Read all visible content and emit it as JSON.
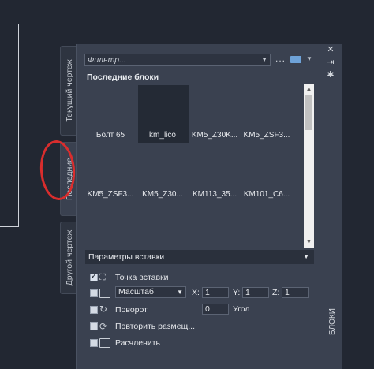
{
  "tabs": [
    {
      "label": "Текущий чертеж",
      "active": false
    },
    {
      "label": "Последние",
      "active": true
    },
    {
      "label": "Другой чертеж",
      "active": false
    }
  ],
  "palette_title": "БЛОКИ",
  "title_icons": [
    "close-icon",
    "pin-icon",
    "settings-icon"
  ],
  "filter": {
    "placeholder": "Фильтр...",
    "more": "...",
    "view_icon": "thumbnail-view-icon"
  },
  "section_title": "Последние блоки",
  "blocks": [
    {
      "label": "Болт 65"
    },
    {
      "label": "km_lico",
      "selected": true
    },
    {
      "label": "KM5_Z30K..."
    },
    {
      "label": "KM5_ZSF3..."
    },
    {
      "label": "KM5_ZSF3..."
    },
    {
      "label": "KM5_Z30..."
    },
    {
      "label": "KM113_35..."
    },
    {
      "label": "KM101_C6..."
    }
  ],
  "insertion": {
    "header": "Параметры вставки",
    "insertion_point": {
      "label": "Точка вставки",
      "checked": true
    },
    "scale": {
      "label": "Масштаб",
      "checked": false,
      "x_label": "X:",
      "x": "1",
      "y_label": "Y:",
      "y": "1",
      "z_label": "Z:",
      "z": "1"
    },
    "rotation": {
      "label": "Поворот",
      "checked": false,
      "angle": "0",
      "angle_label": "Угол"
    },
    "repeat": {
      "label": "Повторить размещ...",
      "checked": false
    },
    "explode": {
      "label": "Расчленить",
      "checked": false
    }
  },
  "colors": {
    "accent": "#6ea2d8",
    "annotation": "#d92d2d"
  }
}
